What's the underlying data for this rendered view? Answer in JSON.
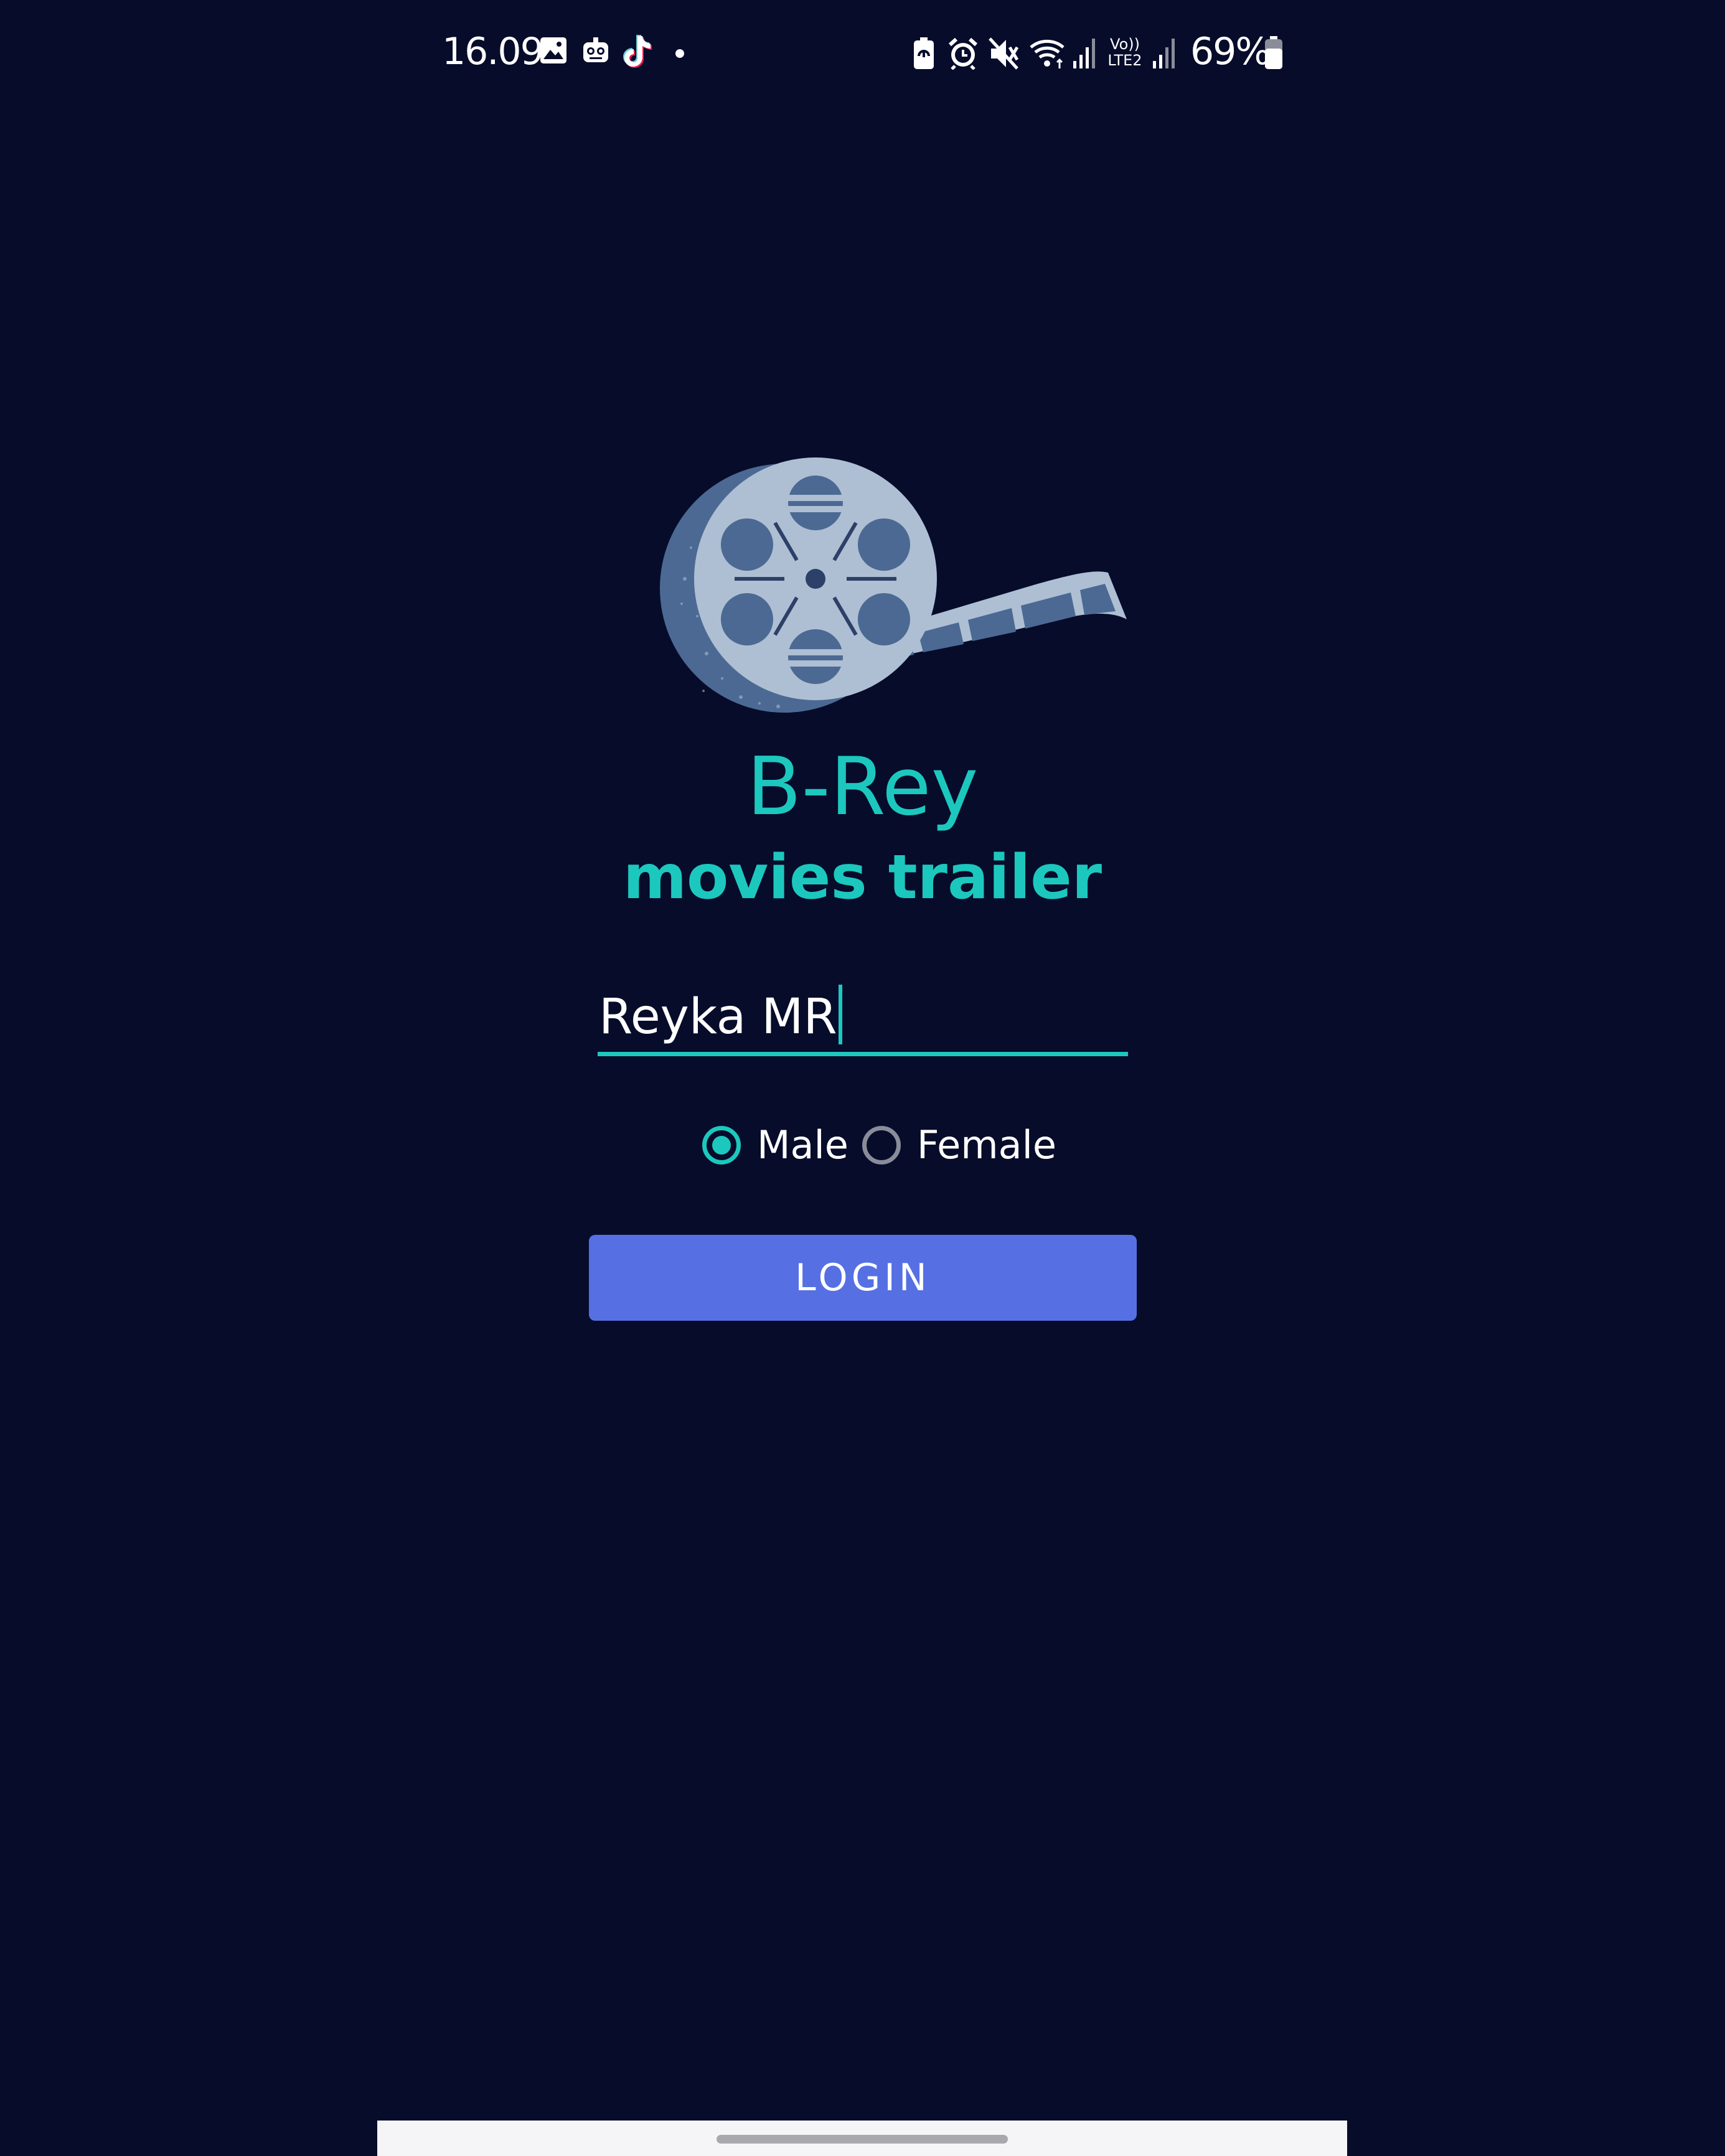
{
  "status_bar": {
    "time": "16.09",
    "left_icons": [
      "gallery-icon",
      "bot-icon",
      "tiktok-icon",
      "dot-icon"
    ],
    "right_icons": [
      "battery-saver-icon",
      "alarm-icon",
      "mute-icon",
      "wifi-icon",
      "signal-icon",
      "volte-lte2-icon",
      "signal-2-icon",
      "battery-icon"
    ],
    "volte_label_top": "Vo))",
    "volte_label_bottom": "LTE2",
    "battery_percent": "69%",
    "battery_level": 0.69
  },
  "app": {
    "title": "B-Rey",
    "subtitle": "movies trailer",
    "logo_icon": "film-reel-icon"
  },
  "login_form": {
    "name_value": "Reyka MR",
    "gender_options": [
      {
        "label": "Male",
        "checked": true
      },
      {
        "label": "Female",
        "checked": false
      }
    ],
    "login_label": "LOGIN"
  },
  "colors": {
    "background": "#070c2b",
    "accent": "#1cc8bd",
    "button": "#5670e4",
    "text": "#ffffff",
    "reel": "#aebfd3",
    "reel_dark": "#4b6993"
  }
}
